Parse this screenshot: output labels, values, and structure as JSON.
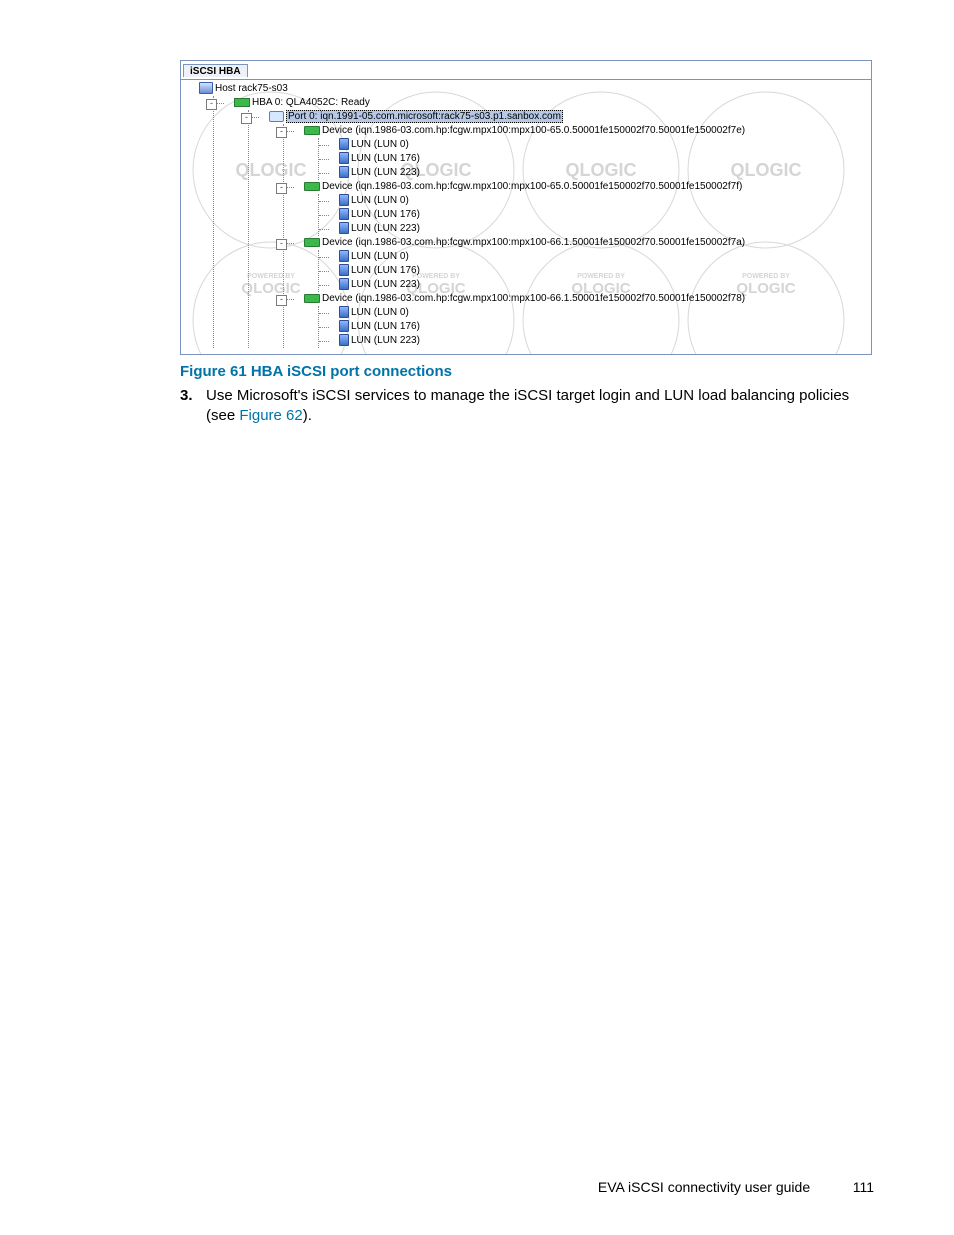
{
  "screenshot": {
    "tab_label": "iSCSI HBA",
    "host": "Host rack75-s03",
    "hba": "HBA 0: QLA4052C: Ready",
    "port": "Port 0: iqn.1991-05.com.microsoft:rack75-s03.p1.sanbox.com",
    "devices": [
      {
        "label": "Device (iqn.1986-03.com.hp:fcgw.mpx100:mpx100-65.0.50001fe150002f70.50001fe150002f7e)",
        "luns": [
          "LUN (LUN 0)",
          "LUN (LUN 176)",
          "LUN (LUN 223)"
        ]
      },
      {
        "label": "Device (iqn.1986-03.com.hp:fcgw.mpx100:mpx100-65.0.50001fe150002f70.50001fe150002f7f)",
        "luns": [
          "LUN (LUN 0)",
          "LUN (LUN 176)",
          "LUN (LUN 223)"
        ]
      },
      {
        "label": "Device (iqn.1986-03.com.hp:fcgw.mpx100:mpx100-66.1.50001fe150002f70.50001fe150002f7a)",
        "luns": [
          "LUN (LUN 0)",
          "LUN (LUN 176)",
          "LUN (LUN 223)"
        ]
      },
      {
        "label": "Device (iqn.1986-03.com.hp:fcgw.mpx100:mpx100-66.1.50001fe150002f70.50001fe150002f78)",
        "luns": [
          "LUN (LUN 0)",
          "LUN (LUN 176)",
          "LUN (LUN 223)"
        ]
      }
    ],
    "watermark_text": "QLOGIC",
    "watermark_sub": "POWERED BY"
  },
  "figure_caption": "Figure 61 HBA iSCSI port connections",
  "step": {
    "number": "3.",
    "text_before": "Use Microsoft's iSCSI services to manage the iSCSI target login and LUN load balancing policies (see ",
    "link": "Figure 62",
    "text_after": ")."
  },
  "footer": {
    "title": "EVA iSCSI connectivity user guide",
    "page": "111"
  }
}
